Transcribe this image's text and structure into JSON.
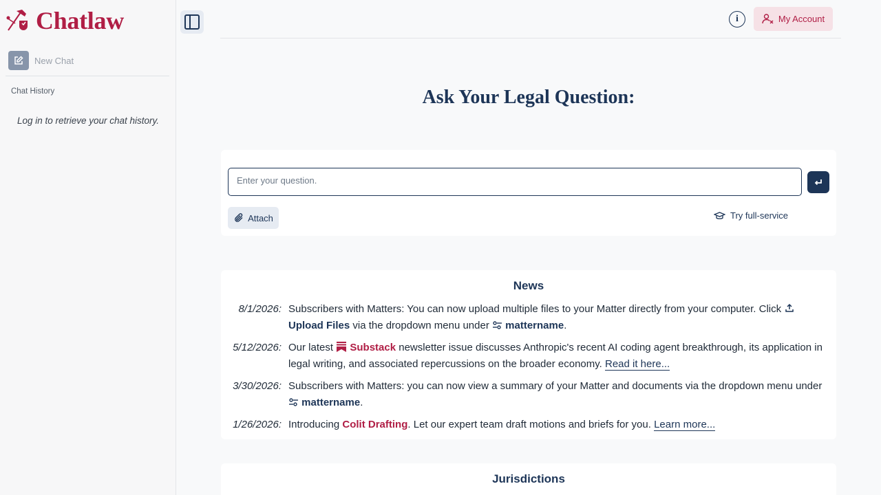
{
  "sidebar": {
    "logo_text": "Chatlaw",
    "new_chat_label": "New Chat",
    "history_title": "Chat History",
    "history_message": "Log in to retrieve your chat history."
  },
  "header": {
    "info_label": "i",
    "account_label": "My Account"
  },
  "main": {
    "heading": "Ask Your Legal Question:",
    "input_placeholder": "Enter your question.",
    "attach_label": "Attach",
    "try_label": "Try full-service"
  },
  "news": {
    "title": "News",
    "items": [
      {
        "date": "8/1/2026:",
        "text1": "Subscribers with Matters: You can now upload multiple files to your Matter directly from your computer. Click ",
        "link": "Upload Files",
        "text2": " via the dropdown menu under ",
        "matter": "mattername",
        "text3": "."
      },
      {
        "date": "5/12/2026:",
        "text1": "Our latest ",
        "brand": "Substack",
        "text2": " newsletter issue discusses Anthropic's recent AI coding agent breakthrough, its application in legal writing, and associated repercussions on the broader economy. ",
        "link": "Read it here..."
      },
      {
        "date": "3/30/2026:",
        "text1": "Subscribers with Matters: you can now view a summary of your Matter and documents via the dropdown menu under ",
        "matter": "mattername",
        "text2": "."
      },
      {
        "date": "1/26/2026:",
        "text1": "Introducing ",
        "brand": "Colit Drafting",
        "text2": ". Let our expert team draft motions and briefs for you. ",
        "link": "Learn more..."
      }
    ]
  },
  "jurisdictions": {
    "title": "Jurisdictions"
  },
  "colors": {
    "brand": "#b01e45",
    "navy": "#1d3557",
    "sidebar_bg": "#f7f7f8"
  },
  "icons": [
    "scales-logo-icon",
    "edit-icon",
    "sidebar-toggle-icon",
    "info-icon",
    "user-x-icon",
    "enter-icon",
    "paperclip-icon",
    "graduation-cap-icon",
    "upload-icon",
    "sliders-icon",
    "bookmark-icon"
  ]
}
